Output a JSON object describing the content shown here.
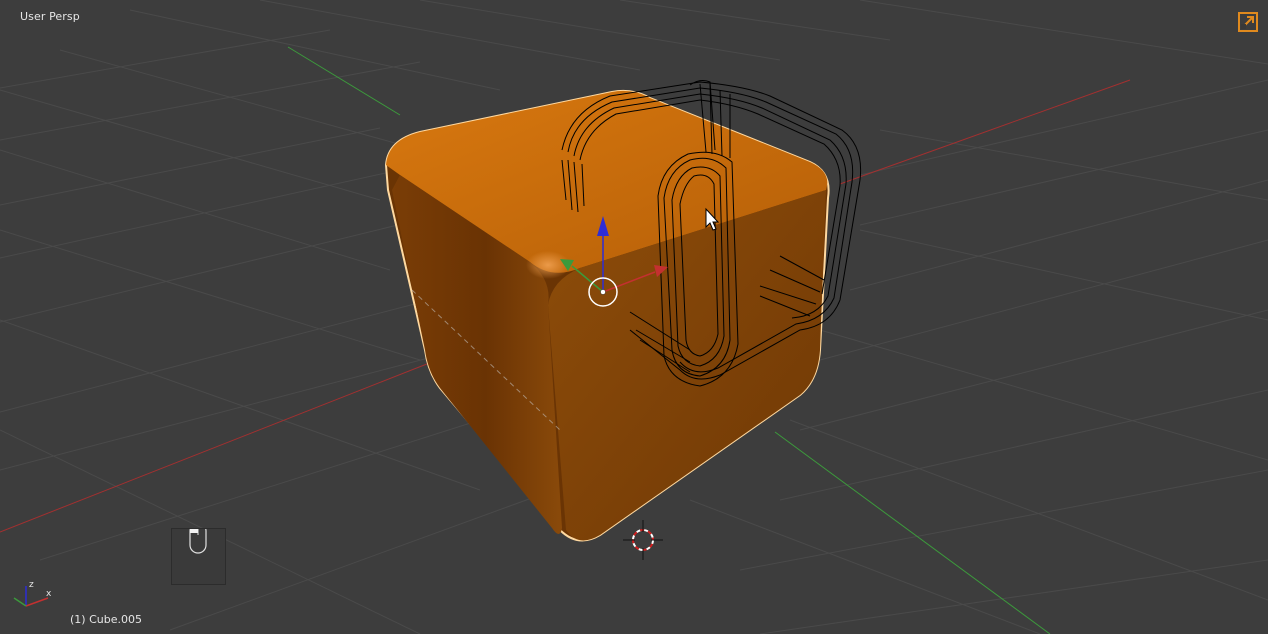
{
  "viewport": {
    "view_name": "User Persp",
    "object_info": "(1) Cube.005",
    "background_color": "#3d3d3d"
  },
  "icons": {
    "maximize": "maximize-view-icon",
    "cursor": "3d-cursor-icon",
    "mouse": "mouse-pointer-icon",
    "axis": "axis-orientation-icon",
    "manipulator": "transform-manipulator-icon"
  },
  "axis_widget": {
    "x_label": "x",
    "z_label": "z"
  },
  "colors": {
    "object_orange": "#c8640a",
    "selection_outline": "#ffd9a0",
    "x_axis": "#a33030",
    "y_axis": "#3c9a3c",
    "z_axis": "#2d2dd6",
    "accent": "#e08a1e"
  }
}
